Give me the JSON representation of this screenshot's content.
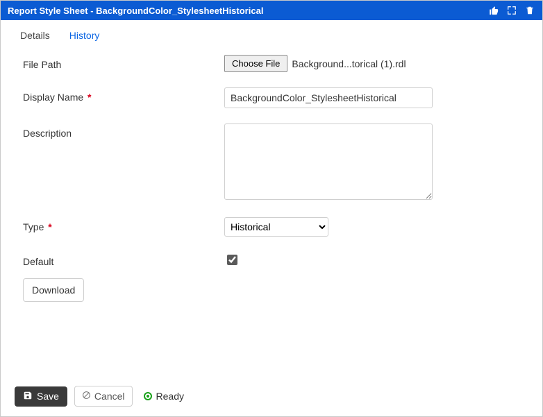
{
  "window": {
    "title": "Report Style Sheet - BackgroundColor_StylesheetHistorical"
  },
  "tabs": {
    "details": "Details",
    "history": "History",
    "active": "details"
  },
  "form": {
    "filePath": {
      "label": "File Path",
      "button": "Choose File",
      "fileName": "Background...torical (1).rdl"
    },
    "displayName": {
      "label": "Display Name",
      "value": "BackgroundColor_StylesheetHistorical"
    },
    "description": {
      "label": "Description",
      "value": ""
    },
    "type": {
      "label": "Type",
      "selected": "Historical"
    },
    "default": {
      "label": "Default",
      "checked": true
    },
    "download": {
      "label": "Download"
    }
  },
  "footer": {
    "save": "Save",
    "cancel": "Cancel",
    "status": "Ready"
  }
}
